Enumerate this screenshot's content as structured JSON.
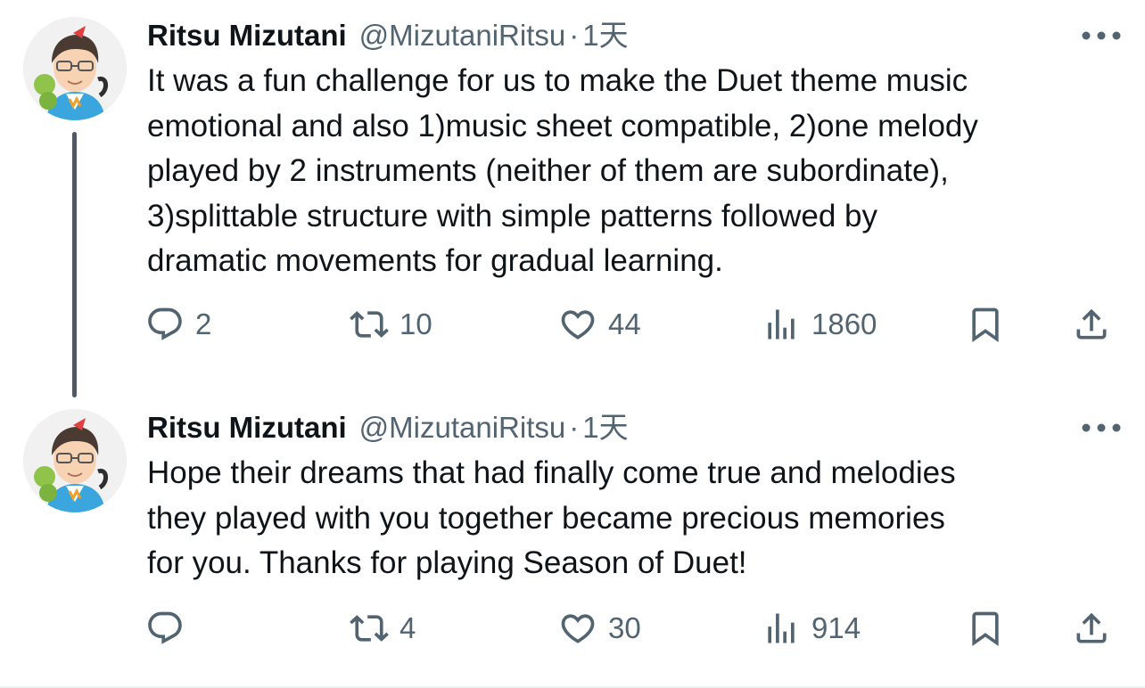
{
  "tweets": [
    {
      "author_name": "Ritsu Mizutani",
      "handle": "@MizutaniRitsu",
      "separator": "·",
      "time": "1天",
      "text": "It was a fun challenge for us to make the Duet theme music\nemotional and also 1)music sheet compatible, 2)one melody\nplayed by 2 instruments (neither of them are subordinate),\n3)splittable structure with simple patterns followed by\ndramatic movements for gradual learning.",
      "replies": "2",
      "retweets": "10",
      "likes": "44",
      "views": "1860"
    },
    {
      "author_name": "Ritsu Mizutani",
      "handle": "@MizutaniRitsu",
      "separator": "·",
      "time": "1天",
      "text": "Hope their dreams that had finally come true and melodies\nthey played with you together became precious memories\nfor you. Thanks for playing Season of Duet!",
      "replies": "",
      "retweets": "4",
      "likes": "30",
      "views": "914"
    }
  ],
  "icons": [
    "more-icon",
    "reply-icon",
    "retweet-icon",
    "like-icon",
    "views-icon",
    "bookmark-icon",
    "share-icon"
  ],
  "colors": {
    "text": "#0f1419",
    "secondary": "#536471",
    "thread_line": "#4f5a64"
  }
}
